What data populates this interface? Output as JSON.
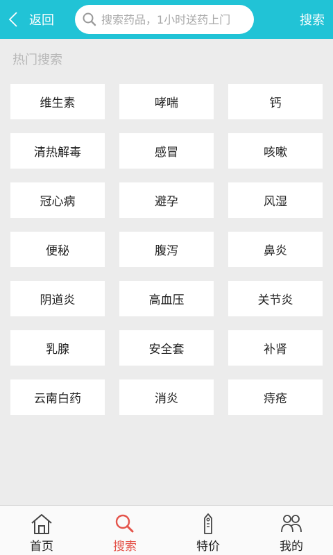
{
  "header": {
    "back_label": "返回",
    "search_placeholder": "搜索药品，1小时送药上门",
    "search_action": "搜索"
  },
  "hot_search": {
    "title": "热门搜索",
    "tags": [
      "维生素",
      "哮喘",
      "钙",
      "清热解毒",
      "感冒",
      "咳嗽",
      "冠心病",
      "避孕",
      "风湿",
      "便秘",
      "腹泻",
      "鼻炎",
      "阴道炎",
      "高血压",
      "关节炎",
      "乳腺",
      "安全套",
      "补肾",
      "云南白药",
      "消炎",
      "痔疮"
    ]
  },
  "bottom_nav": {
    "items": [
      {
        "label": "首页",
        "icon": "home-icon"
      },
      {
        "label": "搜索",
        "icon": "search-icon",
        "active": true
      },
      {
        "label": "特价",
        "icon": "price-tag-icon"
      },
      {
        "label": "我的",
        "icon": "user-icon"
      }
    ]
  },
  "colors": {
    "header_bg": "#21c3d6",
    "active_nav": "#e4534a",
    "page_bg": "#ececec"
  }
}
